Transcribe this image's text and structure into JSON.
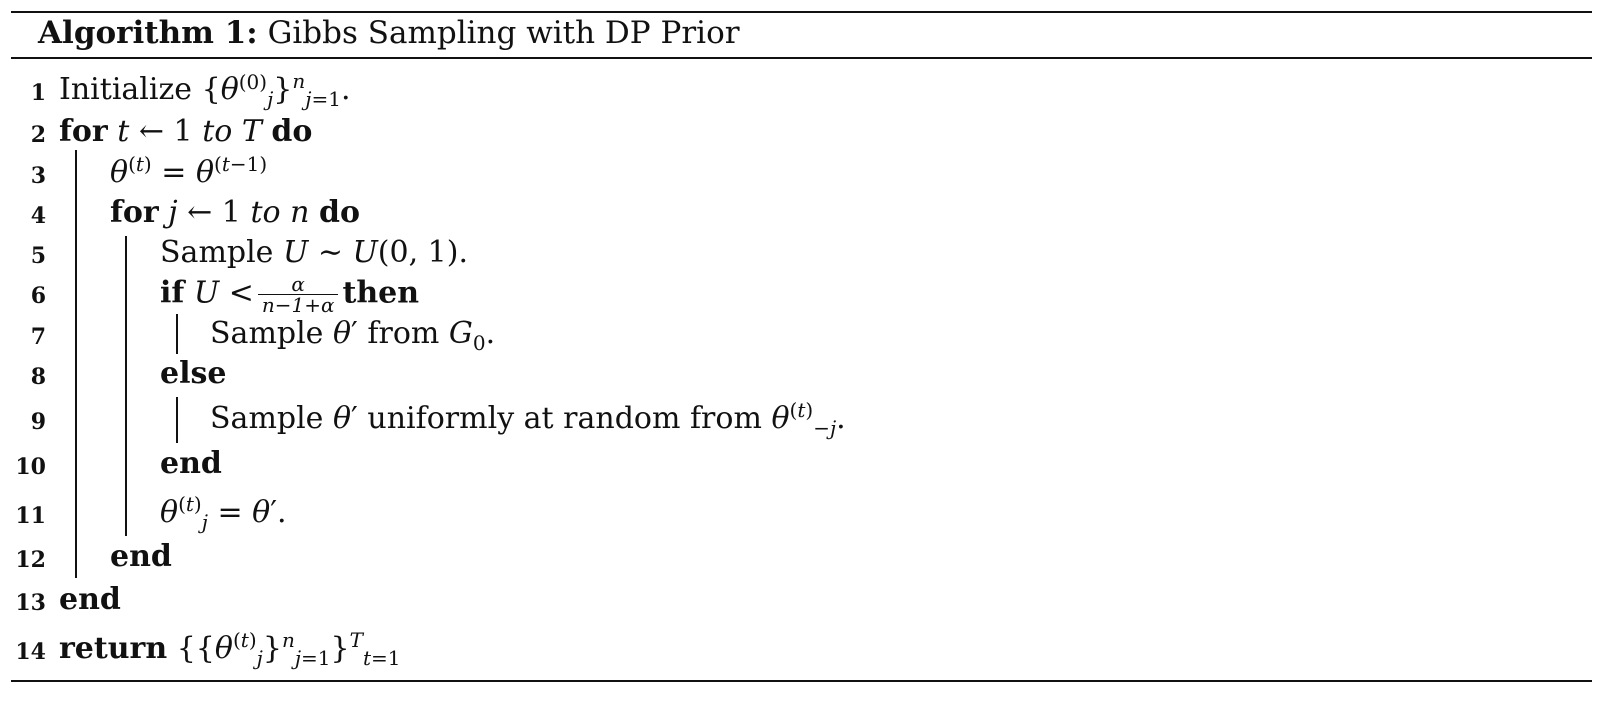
{
  "caption": {
    "label": "Algorithm 1:",
    "title": "Gibbs Sampling with DP Prior"
  },
  "lines": [
    {
      "no": "1",
      "kw": "",
      "text": "Initialize"
    },
    {
      "no": "2",
      "kw": "for",
      "text": "t ← 1",
      "to": "to",
      "end_text": "T",
      "kw2": "do"
    },
    {
      "no": "3",
      "kw": "",
      "text": ""
    },
    {
      "no": "4",
      "kw": "for",
      "text": "j ← 1",
      "to": "to",
      "end_text": "n",
      "kw2": "do"
    },
    {
      "no": "5",
      "kw": "",
      "text": "Sample"
    },
    {
      "no": "6",
      "kw": "if",
      "text": "U <",
      "kw2": "then"
    },
    {
      "no": "7",
      "kw": "",
      "text": "Sample",
      "mid": "from"
    },
    {
      "no": "8",
      "kw": "else",
      "text": ""
    },
    {
      "no": "9",
      "kw": "",
      "text": "Sample",
      "mid": "uniformly at random from"
    },
    {
      "no": "10",
      "kw": "end",
      "text": ""
    },
    {
      "no": "11",
      "kw": "",
      "text": ""
    },
    {
      "no": "12",
      "kw": "end",
      "text": ""
    },
    {
      "no": "13",
      "kw": "end",
      "text": ""
    },
    {
      "no": "14",
      "kw": "return",
      "text": ""
    }
  ],
  "fraction": {
    "numerator": "α",
    "denominator": "n−1+α"
  }
}
